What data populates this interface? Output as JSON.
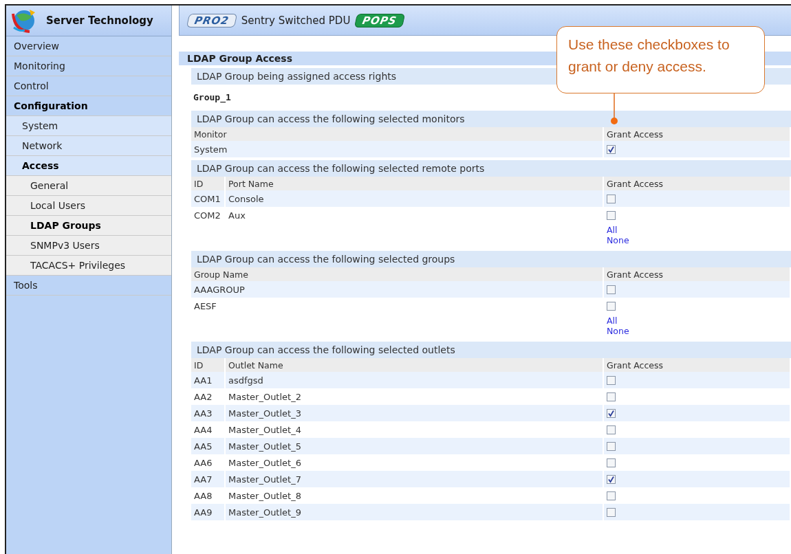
{
  "sidebar": {
    "brand": "Server Technology",
    "items": [
      {
        "label": "Overview",
        "selected": false
      },
      {
        "label": "Monitoring",
        "selected": false
      },
      {
        "label": "Control",
        "selected": false
      },
      {
        "label": "Configuration",
        "selected": true,
        "children": [
          {
            "label": "System",
            "selected": false
          },
          {
            "label": "Network",
            "selected": false
          },
          {
            "label": "Access",
            "selected": true,
            "children": [
              {
                "label": "General",
                "selected": false
              },
              {
                "label": "Local Users",
                "selected": false
              },
              {
                "label": "LDAP Groups",
                "selected": true
              },
              {
                "label": "SNMPv3 Users",
                "selected": false
              },
              {
                "label": "TACACS+ Privileges",
                "selected": false
              }
            ]
          }
        ]
      },
      {
        "label": "Tools",
        "selected": false
      }
    ]
  },
  "header": {
    "model_badge": "PRO2",
    "title": "Sentry Switched PDU",
    "edition_badge": "POPS"
  },
  "page_title": "LDAP Group Access",
  "sections": [
    {
      "kind": "info",
      "heading": "LDAP Group being assigned access rights",
      "value": "Group_1"
    },
    {
      "kind": "table",
      "heading": "LDAP Group can access the following selected monitors",
      "columns": [
        "Monitor",
        "Grant Access"
      ],
      "rows": [
        {
          "cells": [
            "System"
          ],
          "checked": true
        }
      ]
    },
    {
      "kind": "table",
      "heading": "LDAP Group can access the following selected remote ports",
      "columns": [
        "ID",
        "Port Name",
        "Grant Access"
      ],
      "rows": [
        {
          "cells": [
            "COM1",
            "Console"
          ],
          "checked": false
        },
        {
          "cells": [
            "COM2",
            "Aux"
          ],
          "checked": false
        }
      ],
      "links": [
        "All",
        "None"
      ]
    },
    {
      "kind": "table",
      "heading": "LDAP Group can access the following selected groups",
      "columns": [
        "Group Name",
        "Grant Access"
      ],
      "rows": [
        {
          "cells": [
            "AAAGROUP"
          ],
          "checked": false
        },
        {
          "cells": [
            "AESF"
          ],
          "checked": false
        }
      ],
      "links": [
        "All",
        "None"
      ]
    },
    {
      "kind": "table",
      "heading": "LDAP Group can access the following selected outlets",
      "columns": [
        "ID",
        "Outlet Name",
        "Grant Access"
      ],
      "rows": [
        {
          "cells": [
            "AA1",
            "asdfgsd"
          ],
          "checked": false
        },
        {
          "cells": [
            "AA2",
            "Master_Outlet_2"
          ],
          "checked": false
        },
        {
          "cells": [
            "AA3",
            "Master_Outlet_3"
          ],
          "checked": true
        },
        {
          "cells": [
            "AA4",
            "Master_Outlet_4"
          ],
          "checked": false
        },
        {
          "cells": [
            "AA5",
            "Master_Outlet_5"
          ],
          "checked": false
        },
        {
          "cells": [
            "AA6",
            "Master_Outlet_6"
          ],
          "checked": false
        },
        {
          "cells": [
            "AA7",
            "Master_Outlet_7"
          ],
          "checked": true
        },
        {
          "cells": [
            "AA8",
            "Master_Outlet_8"
          ],
          "checked": false
        },
        {
          "cells": [
            "AA9",
            "Master_Outlet_9"
          ],
          "checked": false
        }
      ]
    }
  ],
  "callout": {
    "text": "Use these checkboxes to grant or deny access."
  }
}
